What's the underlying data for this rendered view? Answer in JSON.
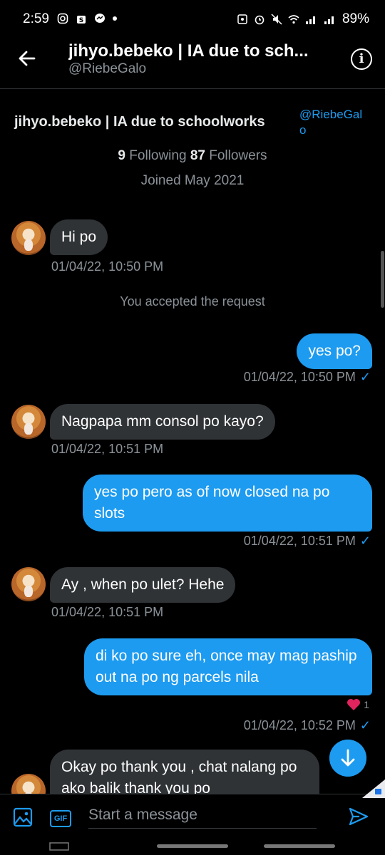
{
  "status_bar": {
    "time": "2:59",
    "battery": "89%"
  },
  "header": {
    "title": "jihyo.bebeko | IA due to sch...",
    "handle": "@RiebeGalo"
  },
  "profile": {
    "name": "jihyo.bebeko | IA due to schoolworks",
    "handle": "@RiebeGalo",
    "following_count": "9",
    "following_label": "Following",
    "followers_count": "87",
    "followers_label": "Followers",
    "joined": "Joined May 2021"
  },
  "messages": [
    {
      "direction": "in",
      "text": "Hi po",
      "time": "01/04/22, 10:50 PM"
    },
    {
      "direction": "system",
      "text": "You accepted the request"
    },
    {
      "direction": "out",
      "text": "yes po?",
      "time": "01/04/22, 10:50 PM"
    },
    {
      "direction": "in",
      "text": "Nagpapa mm consol po kayo?",
      "time": "01/04/22, 10:51 PM"
    },
    {
      "direction": "out",
      "text": "yes po pero as of now closed na po slots",
      "time": "01/04/22, 10:51 PM"
    },
    {
      "direction": "in",
      "text": "Ay , when po ulet? Hehe",
      "time": "01/04/22, 10:51 PM"
    },
    {
      "direction": "out",
      "text": "di ko po sure eh, once may mag paship out na po ng parcels nila",
      "time": "01/04/22, 10:52 PM",
      "reaction_count": "1"
    },
    {
      "direction": "in",
      "text": "Okay po thank you , chat nalang po ako balik thank you po"
    }
  ],
  "composer": {
    "placeholder": "Start a message",
    "gif_label": "GIF"
  },
  "colors": {
    "accent": "#1d9bf0",
    "incoming_bubble": "#2f3336",
    "background": "#000000",
    "muted": "#8b9298",
    "heart": "#e0245e"
  },
  "icons": [
    "back-arrow-icon",
    "info-icon",
    "media-icon",
    "gif-icon",
    "send-icon",
    "arrow-down-icon",
    "heart-icon",
    "check-icon"
  ]
}
